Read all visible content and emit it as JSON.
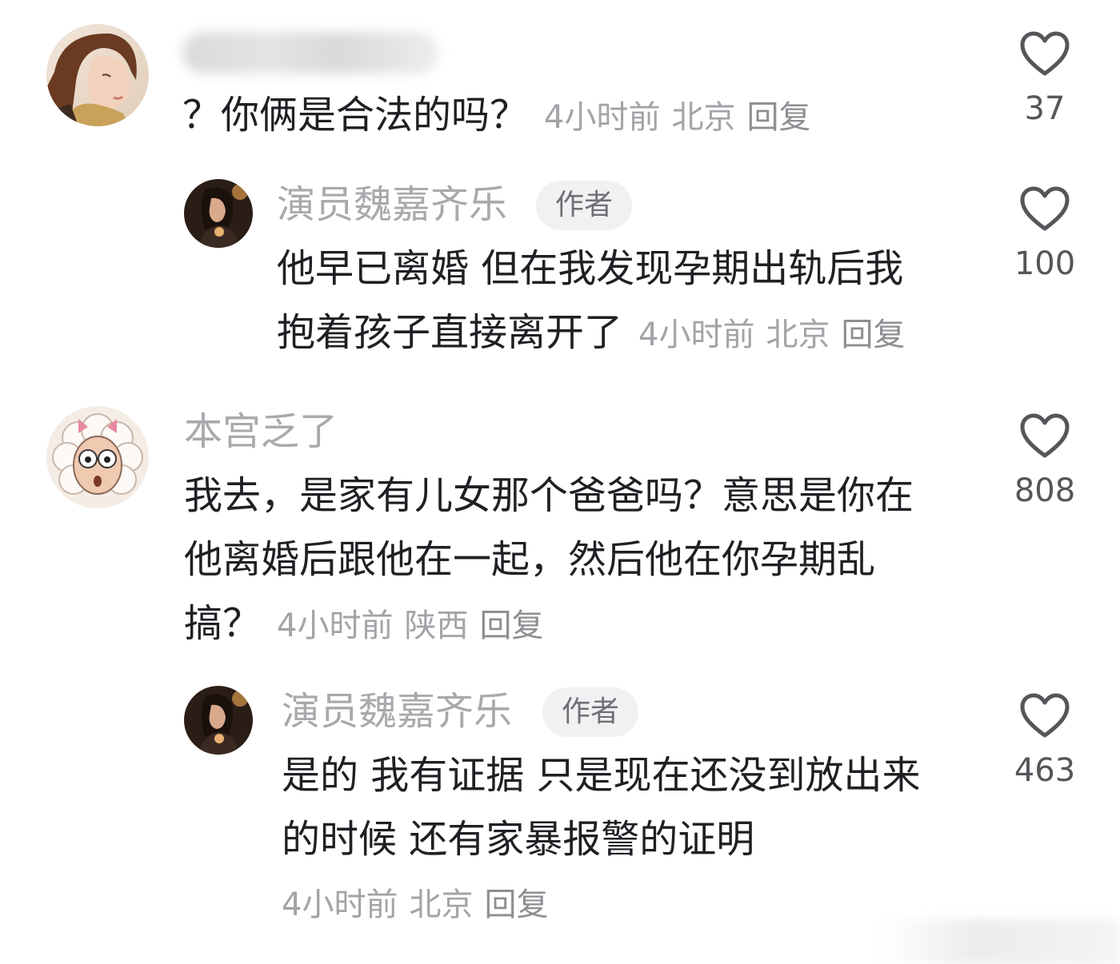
{
  "comments": [
    {
      "avatar": "woman-profile-avatar",
      "text": "？你俩是合法的吗？",
      "time": "4小时前",
      "location": "北京",
      "reply": "回复",
      "likes": "37"
    },
    {
      "avatar": "author-avatar",
      "username": "演员魏嘉齐乐",
      "badge": "作者",
      "lines": [
        "他早已离婚  但在我发现孕期出轨后我",
        "抱着孩子直接离开了"
      ],
      "time": "4小时前",
      "location": "北京",
      "reply": "回复",
      "likes": "100"
    },
    {
      "avatar": "cartoon-sheep-avatar",
      "username": "本宫乏了",
      "lines": [
        "我去，是家有儿女那个爸爸吗？意思是你在",
        "他离婚后跟他在一起，然后他在你孕期乱",
        "搞？"
      ],
      "time": "4小时前",
      "location": "陕西",
      "reply": "回复",
      "likes": "808"
    },
    {
      "avatar": "author-avatar",
      "username": "演员魏嘉齐乐",
      "badge": "作者",
      "lines": [
        "是的 我有证据 只是现在还没到放出来",
        "的时候 还有家暴报警的证明"
      ],
      "time": "4小时前",
      "location": "北京",
      "reply": "回复",
      "likes": "463"
    }
  ],
  "colors": {
    "text": "#1f1f24",
    "username": "#a9a9ad",
    "meta": "#a3a3a8",
    "badge_bg": "#f1f1f3",
    "heart": "#55555a"
  }
}
